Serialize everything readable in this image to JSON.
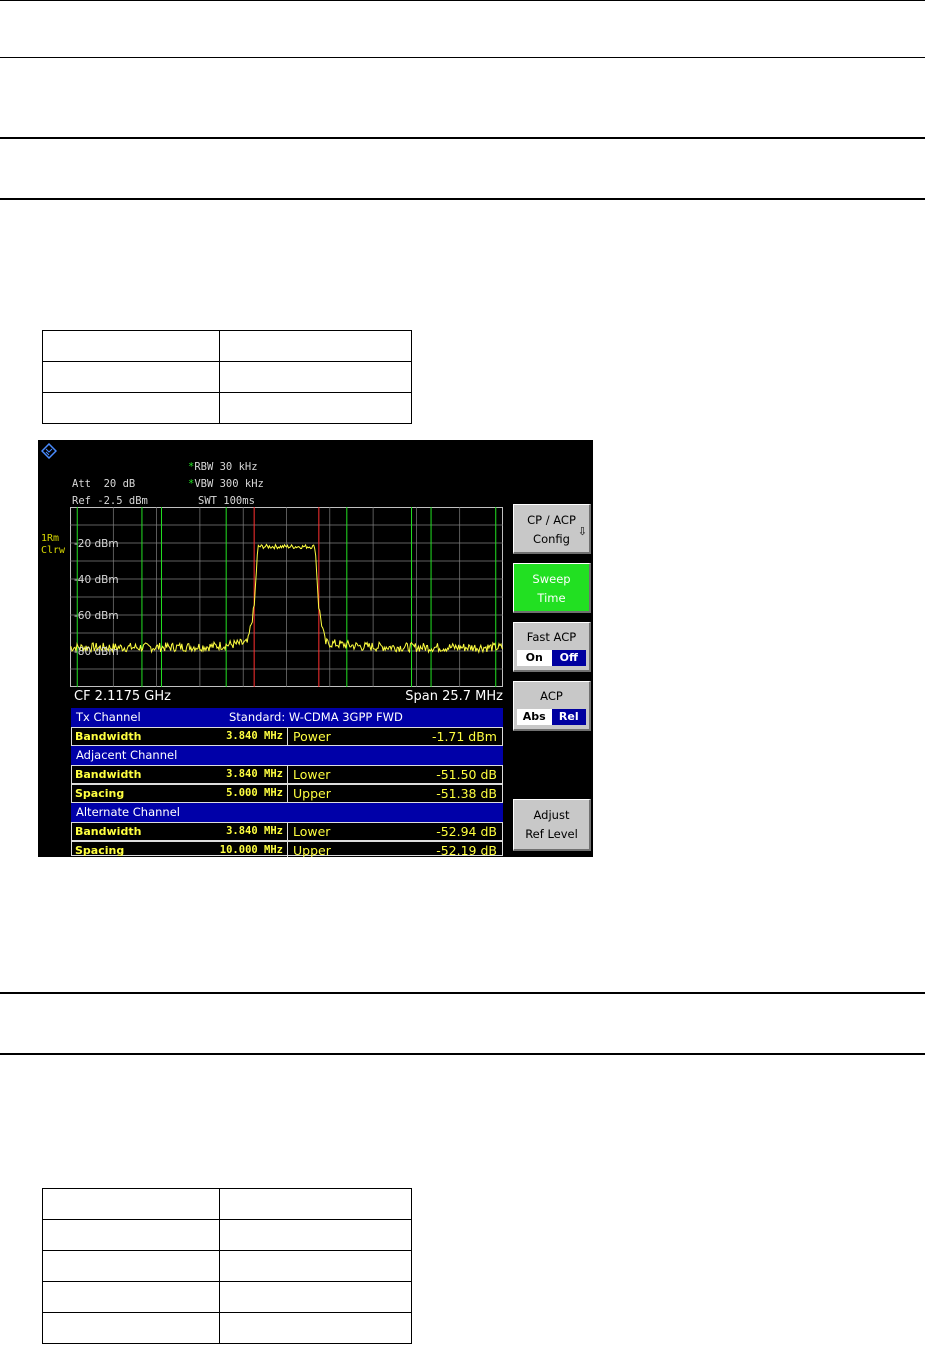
{
  "screen": {
    "header": {
      "rbw": "RBW 30 kHz",
      "vbw": "VBW 300 kHz",
      "swt": "SWT 100ms",
      "att": "Att  20 dB",
      "ref": "Ref -2.5 dBm",
      "star": "*"
    },
    "trace_label": [
      "1Rm",
      "Clrw"
    ],
    "cf": "CF 2.1175 GHz",
    "span": "Span 25.7 MHz",
    "table": {
      "tx_header": "Tx Channel",
      "standard": "Standard: W-CDMA 3GPP FWD",
      "tx_bandwidth_label": "Bandwidth",
      "tx_bandwidth_value": "3.840 MHz",
      "tx_power_label": "Power",
      "tx_power_value": "-1.71 dBm",
      "adj_header": "Adjacent Channel",
      "adj_bandwidth_label": "Bandwidth",
      "adj_bandwidth_value": "3.840 MHz",
      "adj_lower_label": "Lower",
      "adj_lower_value": "-51.50 dB",
      "adj_spacing_label": "Spacing",
      "adj_spacing_value": "5.000 MHz",
      "adj_upper_label": "Upper",
      "adj_upper_value": "-51.38 dB",
      "alt_header": "Alternate Channel",
      "alt_bandwidth_label": "Bandwidth",
      "alt_bandwidth_value": "3.840 MHz",
      "alt_lower_label": "Lower",
      "alt_lower_value": "-52.94 dB",
      "alt_spacing_label": "Spacing",
      "alt_spacing_value": "10.000 MHz",
      "alt_upper_label": "Upper",
      "alt_upper_value": "-52.19 dB"
    },
    "softkeys": {
      "cp_acp_config": [
        "CP / ACP",
        "Config"
      ],
      "sweep_time": [
        "Sweep",
        "Time"
      ],
      "fast_acp": {
        "label": "Fast ACP",
        "on": "On",
        "off": "Off",
        "selected": "Off"
      },
      "acp": {
        "label": "ACP",
        "abs": "Abs",
        "rel": "Rel",
        "selected": "Rel"
      },
      "adjust_ref_level": [
        "Adjust",
        "Ref Level"
      ]
    }
  },
  "chart_data": {
    "type": "line",
    "y_tick_labels": [
      "-20 dBm",
      "-40 dBm",
      "-60 dBm",
      "-80 dBm"
    ],
    "ylim": [
      -100,
      0
    ],
    "series": [
      {
        "values_description_free": true,
        "x_mhz": [
          -12.85,
          -8,
          -4.5,
          -2.3,
          -1.92,
          -1.7,
          1.7,
          1.92,
          2.3,
          4.5,
          8,
          12.85
        ],
        "y_dbm": [
          -78,
          -78,
          -77.5,
          -75.5,
          -56,
          -22,
          -22,
          -56,
          -75.5,
          -77.5,
          -78,
          -78
        ]
      }
    ],
    "colors": {
      "trace": "#ffff40",
      "channel_tx": "#ff3030",
      "channel_adj": "#22e022",
      "grid": "#c0c0c0"
    }
  }
}
